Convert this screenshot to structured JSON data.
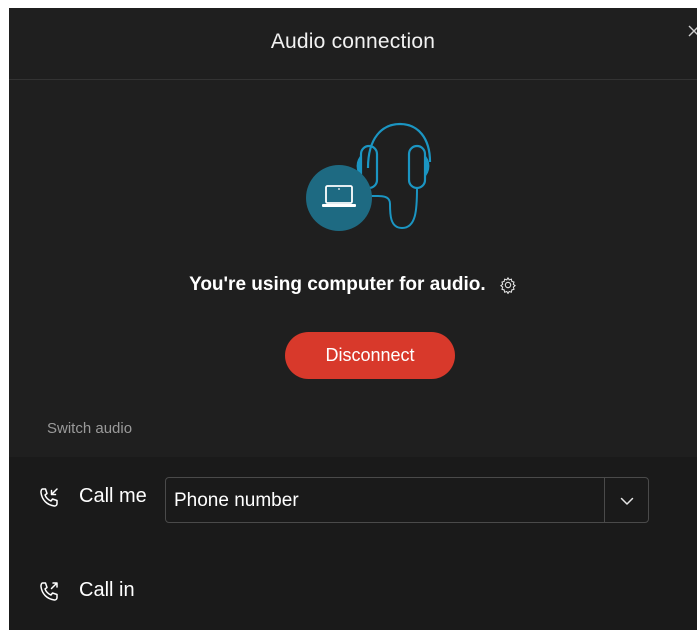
{
  "dialog": {
    "title": "Audio connection",
    "status_text": "You're using computer for audio.",
    "disconnect_label": "Disconnect",
    "switch_audio_label": "Switch audio"
  },
  "options": {
    "call_me": {
      "label": "Call me",
      "selected_value": "Phone number"
    },
    "call_in": {
      "label": "Call in"
    }
  },
  "icons": {
    "close": "close-icon",
    "headset": "headset-laptop-illustration",
    "settings": "gear-icon",
    "call_me": "phone-incoming-icon",
    "call_in": "phone-outgoing-icon",
    "dropdown": "chevron-down-icon"
  },
  "colors": {
    "background": "#1f1f1f",
    "accent": "#1b95c2",
    "accent_fill": "#1e6a82",
    "danger": "#d8392b",
    "muted_text": "#9a9a9a"
  }
}
